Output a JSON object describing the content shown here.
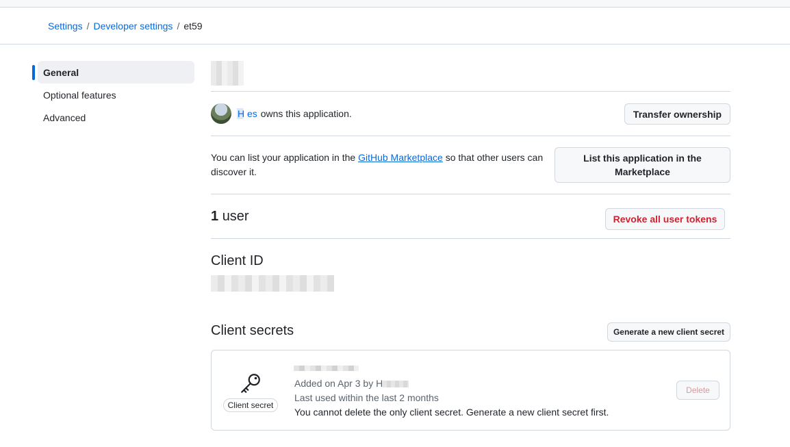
{
  "breadcrumb": {
    "settings": "Settings",
    "developer_settings": "Developer settings",
    "current": "et59",
    "separator": "/"
  },
  "sidebar": {
    "items": [
      {
        "label": "General",
        "active": true
      },
      {
        "label": "Optional features",
        "active": false
      },
      {
        "label": "Advanced",
        "active": false
      }
    ]
  },
  "owner": {
    "username": "H       es",
    "suffix": "owns this application.",
    "transfer_button": "Transfer ownership"
  },
  "marketplace": {
    "text_before": "You can list your application in the",
    "link": "GitHub Marketplace",
    "text_after": "so that other users can discover it.",
    "button": "List this application in the Marketplace"
  },
  "users": {
    "count": "1",
    "label": "user",
    "revoke_button": "Revoke all user tokens"
  },
  "client_id": {
    "title": "Client ID"
  },
  "client_secrets": {
    "title": "Client secrets",
    "generate_button": "Generate a new client secret",
    "secret": {
      "badge": "Client secret",
      "added": "Added on Apr 3 by",
      "added_by": "H",
      "last_used": "Last used within the last 2 months",
      "warning": "You cannot delete the only client secret. Generate a new client secret first.",
      "delete_button": "Delete"
    }
  },
  "colors": {
    "accent": "#0969da",
    "danger": "#cf222e",
    "border": "#d0d7de"
  }
}
